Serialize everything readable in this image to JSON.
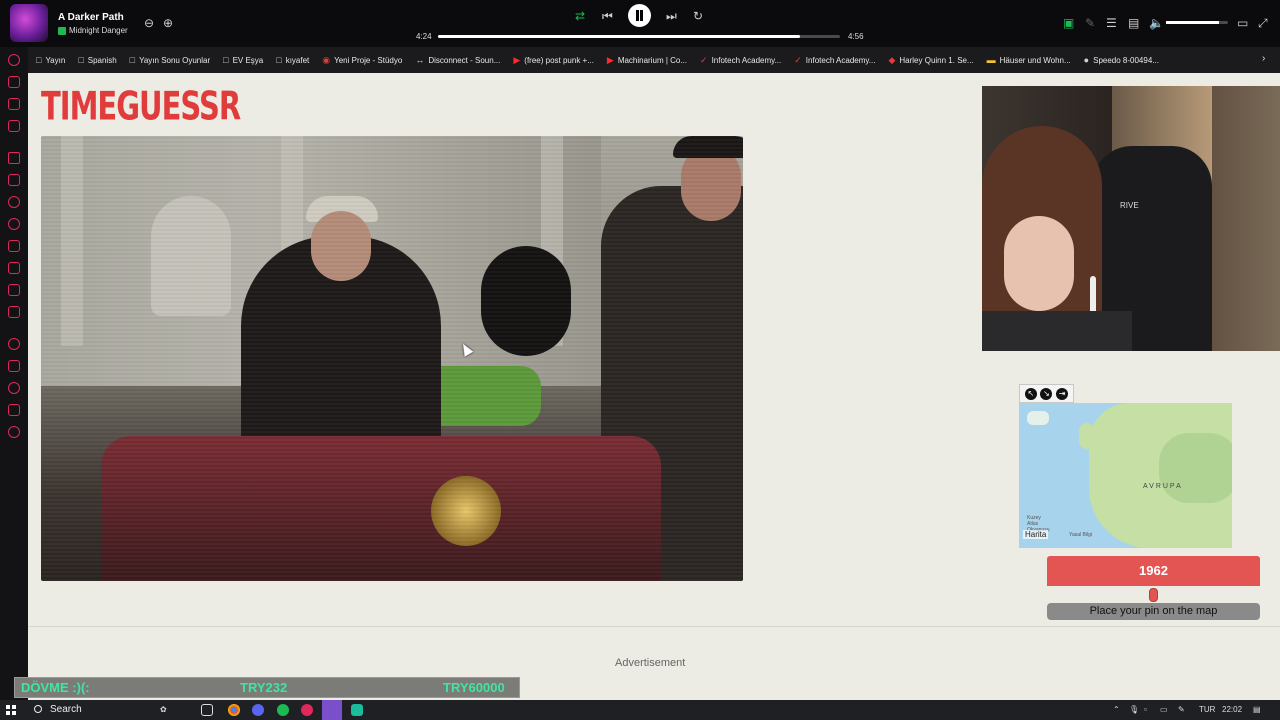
{
  "player": {
    "track_title": "A Darker Path",
    "artist": "Midnight Danger",
    "elapsed": "4:24",
    "duration": "4:56",
    "progress_fraction": 0.901,
    "volume_fraction": 0.85
  },
  "bookmarks": [
    {
      "label": "Yayın",
      "icon": "folder-icon"
    },
    {
      "label": "Spanish",
      "icon": "folder-icon"
    },
    {
      "label": "Yayın Sonu Oyunlar",
      "icon": "folder-icon"
    },
    {
      "label": "EV Eşya",
      "icon": "folder-icon"
    },
    {
      "label": "kıyafet",
      "icon": "folder-icon"
    },
    {
      "label": "Yeni Proje - Stüdyo",
      "icon": "red-circle-icon"
    },
    {
      "label": "Disconnect - Soun...",
      "icon": "soundcloud-icon"
    },
    {
      "label": "(free) post punk +...",
      "icon": "youtube-icon"
    },
    {
      "label": "Machinarium | Co...",
      "icon": "youtube-icon"
    },
    {
      "label": "Infotech Academy...",
      "icon": "red-check-icon"
    },
    {
      "label": "Infotech Academy...",
      "icon": "red-check-icon"
    },
    {
      "label": "Harley Quinn 1. Se...",
      "icon": "red-diamond-icon"
    },
    {
      "label": "Häuser und Wohn...",
      "icon": "yellow-app-icon"
    },
    {
      "label": "Speedo 8-00494...",
      "icon": "speedo-icon"
    }
  ],
  "game": {
    "logo": "TIMEGUESSR",
    "webcam_chair_text": "RIVE",
    "year": "1962",
    "year_slider_fraction": 0.5,
    "pin_prompt": "Place your pin on the map",
    "advertisement_label": "Advertisement",
    "map": {
      "brand": "Harita",
      "region_label": "AVRUPA",
      "ocean_label_line1": "Kuzey",
      "ocean_label_line2": "Atlas",
      "ocean_label_line3": "Okyanusu",
      "legal": "Yasal Bilgi"
    }
  },
  "donation": {
    "message": "DÖVME :)(:",
    "amount": "TRY232",
    "goal": "TRY60000"
  },
  "taskbar": {
    "search_label": "Search",
    "language": "TUR",
    "clock": "22:02"
  },
  "colors": {
    "brand_red": "#e03c3c",
    "donation_text": "#3ee6a2",
    "page_bg": "#ecebe4"
  }
}
